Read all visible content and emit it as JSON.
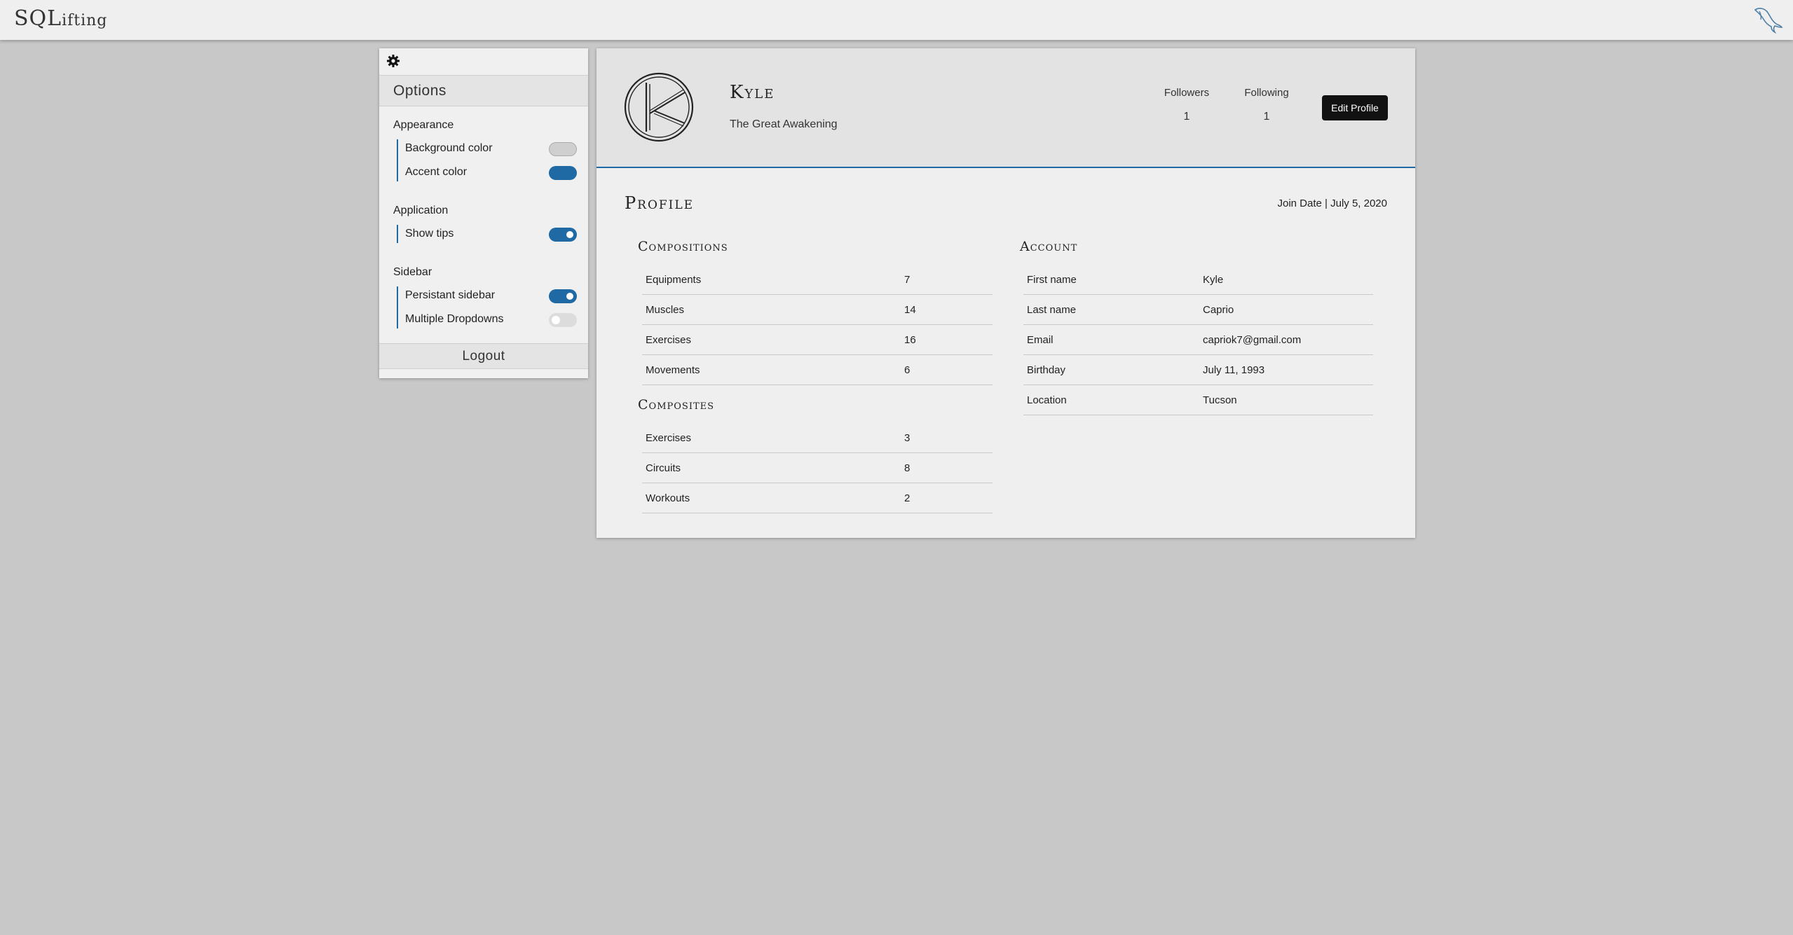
{
  "header": {
    "brand": "SQLifting",
    "brand_main": "SQL",
    "brand_rest": "ifting"
  },
  "options": {
    "title": "Options",
    "logout_label": "Logout",
    "groups": [
      {
        "label": "Appearance",
        "items": [
          {
            "label": "Background color",
            "state": "grey-swatch"
          },
          {
            "label": "Accent color",
            "state": "blue-swatch"
          }
        ]
      },
      {
        "label": "Application",
        "items": [
          {
            "label": "Show tips",
            "state": "on"
          }
        ]
      },
      {
        "label": "Sidebar",
        "items": [
          {
            "label": "Persistant sidebar",
            "state": "on"
          },
          {
            "label": "Multiple Dropdowns",
            "state": "off"
          }
        ]
      }
    ]
  },
  "profile": {
    "name": "Kyle",
    "tagline": "The Great Awakening",
    "followers_label": "Followers",
    "followers": "1",
    "following_label": "Following",
    "following": "1",
    "edit_label": "Edit Profile",
    "section_title": "Profile",
    "join_date": "Join Date | July 5, 2020",
    "compositions_title": "Compositions",
    "compositions": [
      {
        "k": "Equipments",
        "v": "7"
      },
      {
        "k": "Muscles",
        "v": "14"
      },
      {
        "k": "Exercises",
        "v": "16"
      },
      {
        "k": "Movements",
        "v": "6"
      }
    ],
    "composites_title": "Composites",
    "composites": [
      {
        "k": "Exercises",
        "v": "3"
      },
      {
        "k": "Circuits",
        "v": "8"
      },
      {
        "k": "Workouts",
        "v": "2"
      }
    ],
    "account_title": "Account",
    "account": [
      {
        "k": "First name",
        "v": "Kyle"
      },
      {
        "k": "Last name",
        "v": "Caprio"
      },
      {
        "k": "Email",
        "v": "capriok7@gmail.com"
      },
      {
        "k": "Birthday",
        "v": "July 11, 1993"
      },
      {
        "k": "Location",
        "v": "Tucson"
      }
    ]
  },
  "colors": {
    "accent": "#1f6aa5",
    "background": "#c8c8c8",
    "panel": "#efefef"
  },
  "icons": {
    "settings": "gear-icon",
    "logo": "dolphin-icon",
    "avatar": "k-monogram-logo"
  }
}
